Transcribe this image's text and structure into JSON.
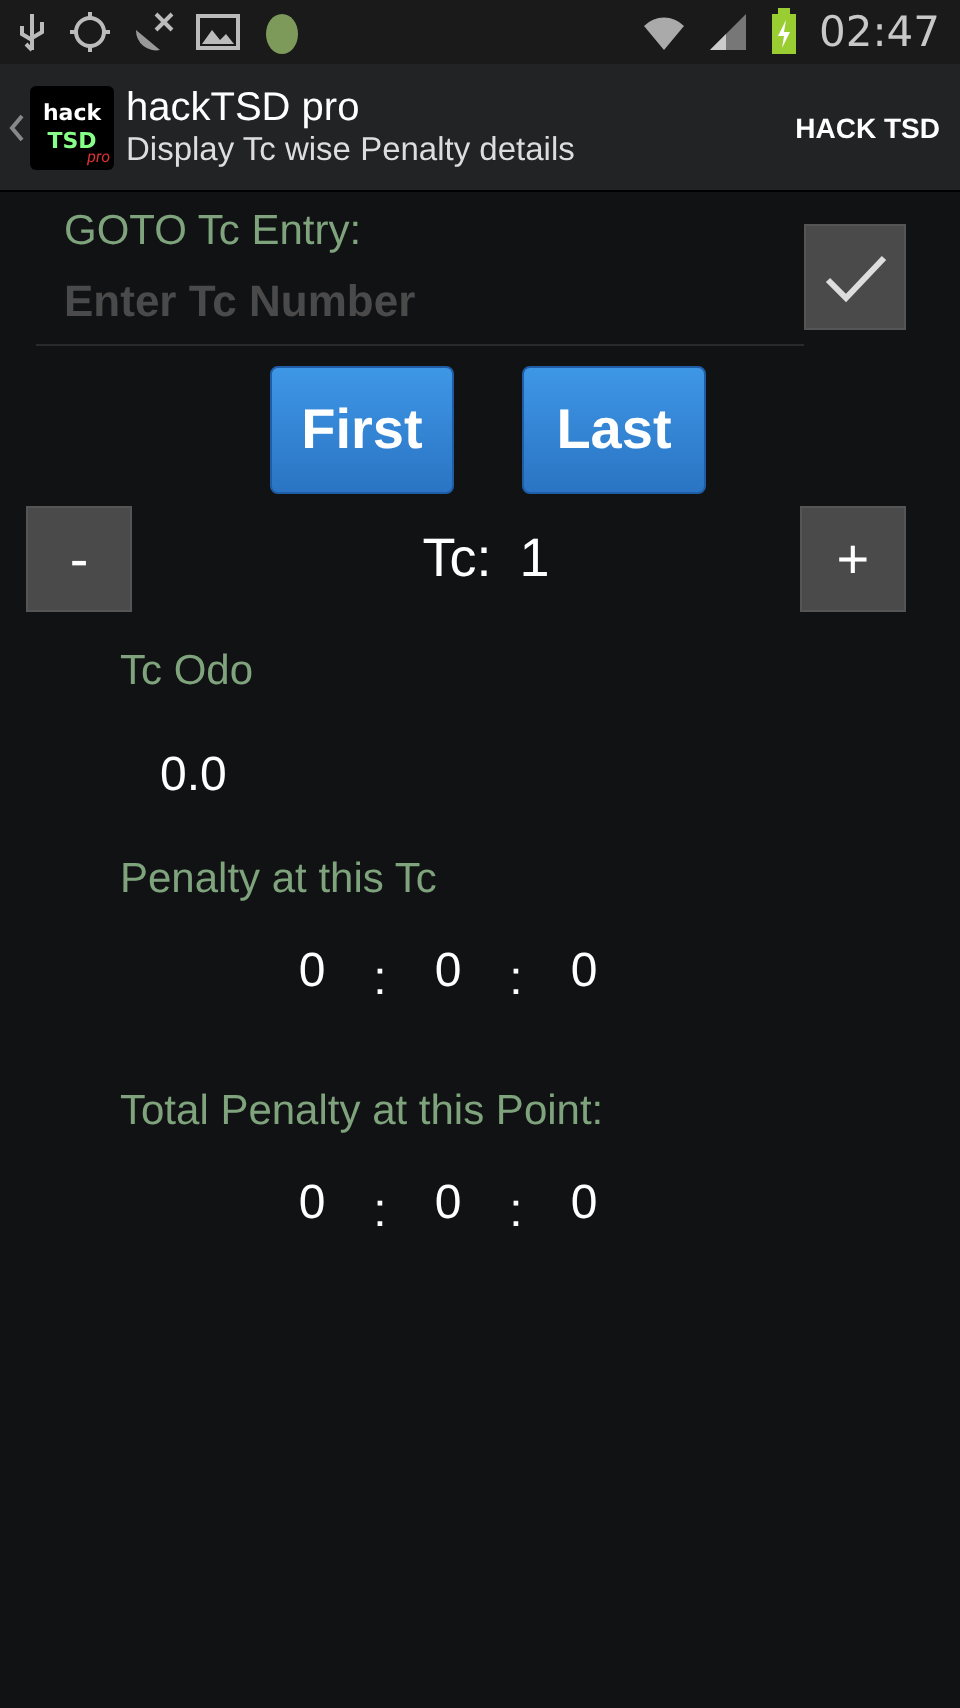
{
  "status_bar": {
    "time": "02:47"
  },
  "action_bar": {
    "logo": {
      "line_1": "hack",
      "line_2": "TSD",
      "line_3": "pro"
    },
    "title": "hackTSD pro",
    "subtitle": "Display Tc wise Penalty details",
    "action": "HACK TSD"
  },
  "goto": {
    "label": "GOTO Tc Entry:",
    "placeholder": "Enter Tc Number"
  },
  "nav_buttons": [
    "First",
    "Last"
  ],
  "stepper": {
    "minus": "-",
    "label": "Tc:",
    "value": "1",
    "plus": "+"
  },
  "odo": {
    "label": "Tc Odo",
    "value": "0.0"
  },
  "penalties": [
    {
      "label": "Penalty at this Tc",
      "parts": [
        "0",
        ":",
        "0",
        ":",
        "0"
      ]
    },
    {
      "label": "Total Penalty at this Point:",
      "parts": [
        "0",
        ":",
        "0",
        ":",
        "0"
      ]
    }
  ]
}
